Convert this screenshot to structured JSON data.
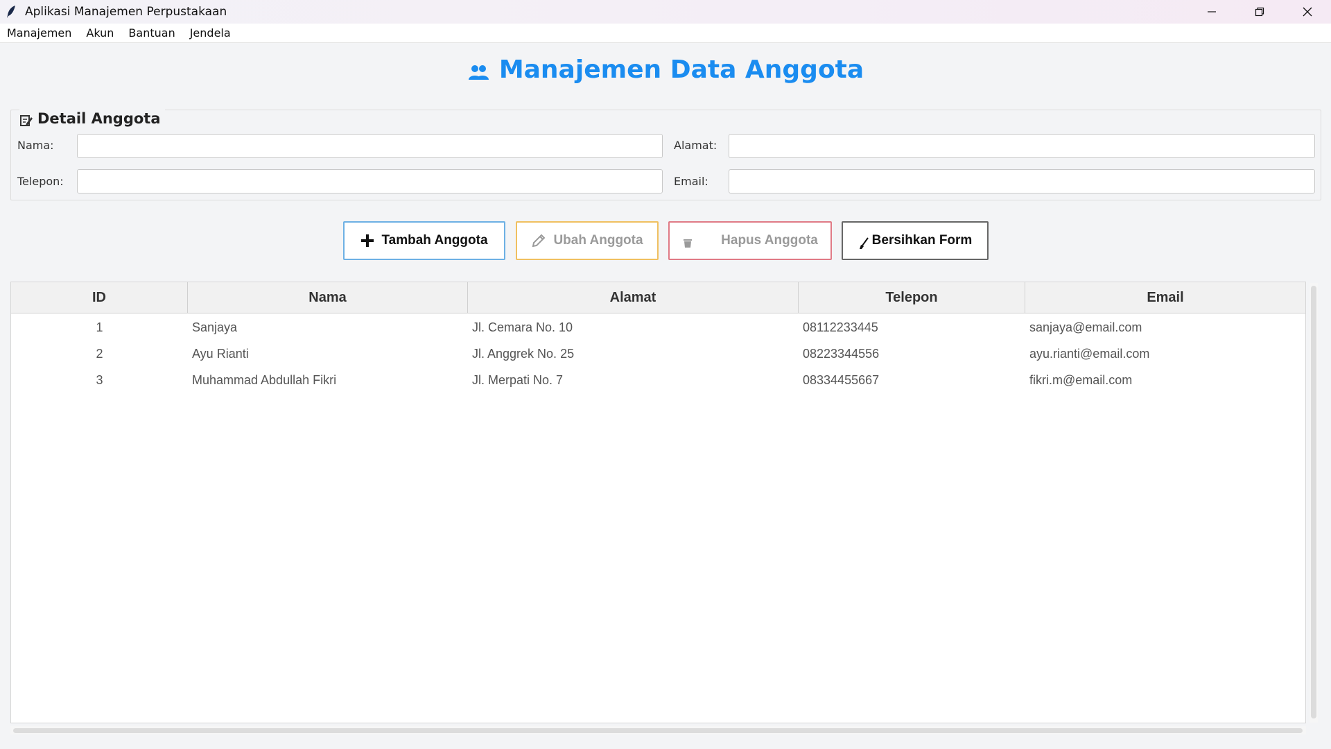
{
  "window": {
    "title": "Aplikasi Manajemen Perpustakaan",
    "icon": "feather-icon"
  },
  "menu": {
    "items": [
      {
        "label": "Manajemen"
      },
      {
        "label": "Akun"
      },
      {
        "label": "Bantuan"
      },
      {
        "label": "Jendela"
      }
    ]
  },
  "header": {
    "title": "Manajemen Data Anggota",
    "icon": "users-icon"
  },
  "form": {
    "legend": "Detail Anggota",
    "legend_icon": "edit-icon",
    "nama_label": "Nama:",
    "nama_value": "",
    "alamat_label": "Alamat:",
    "alamat_value": "",
    "telepon_label": "Telepon:",
    "telepon_value": "",
    "email_label": "Email:",
    "email_value": ""
  },
  "buttons": {
    "add_label": "Tambah Anggota",
    "edit_label": "Ubah Anggota",
    "delete_label": "Hapus Anggota",
    "clear_label": "Bersihkan Form"
  },
  "table": {
    "headers": {
      "id": "ID",
      "nama": "Nama",
      "alamat": "Alamat",
      "telepon": "Telepon",
      "email": "Email"
    },
    "rows": [
      {
        "id": "1",
        "nama": "Sanjaya",
        "alamat": "Jl. Cemara No. 10",
        "telepon": "08112233445",
        "email": "sanjaya@email.com"
      },
      {
        "id": "2",
        "nama": "Ayu Rianti",
        "alamat": "Jl. Anggrek No. 25",
        "telepon": "08223344556",
        "email": "ayu.rianti@email.com"
      },
      {
        "id": "3",
        "nama": "Muhammad Abdullah Fikri",
        "alamat": "Jl. Merpati No. 7",
        "telepon": "08334455667",
        "email": "fikri.m@email.com"
      }
    ]
  },
  "colors": {
    "accent": "#1a8cf0",
    "add_border": "#6db0e4",
    "edit_border": "#f0c060",
    "delete_border": "#e07a86"
  }
}
